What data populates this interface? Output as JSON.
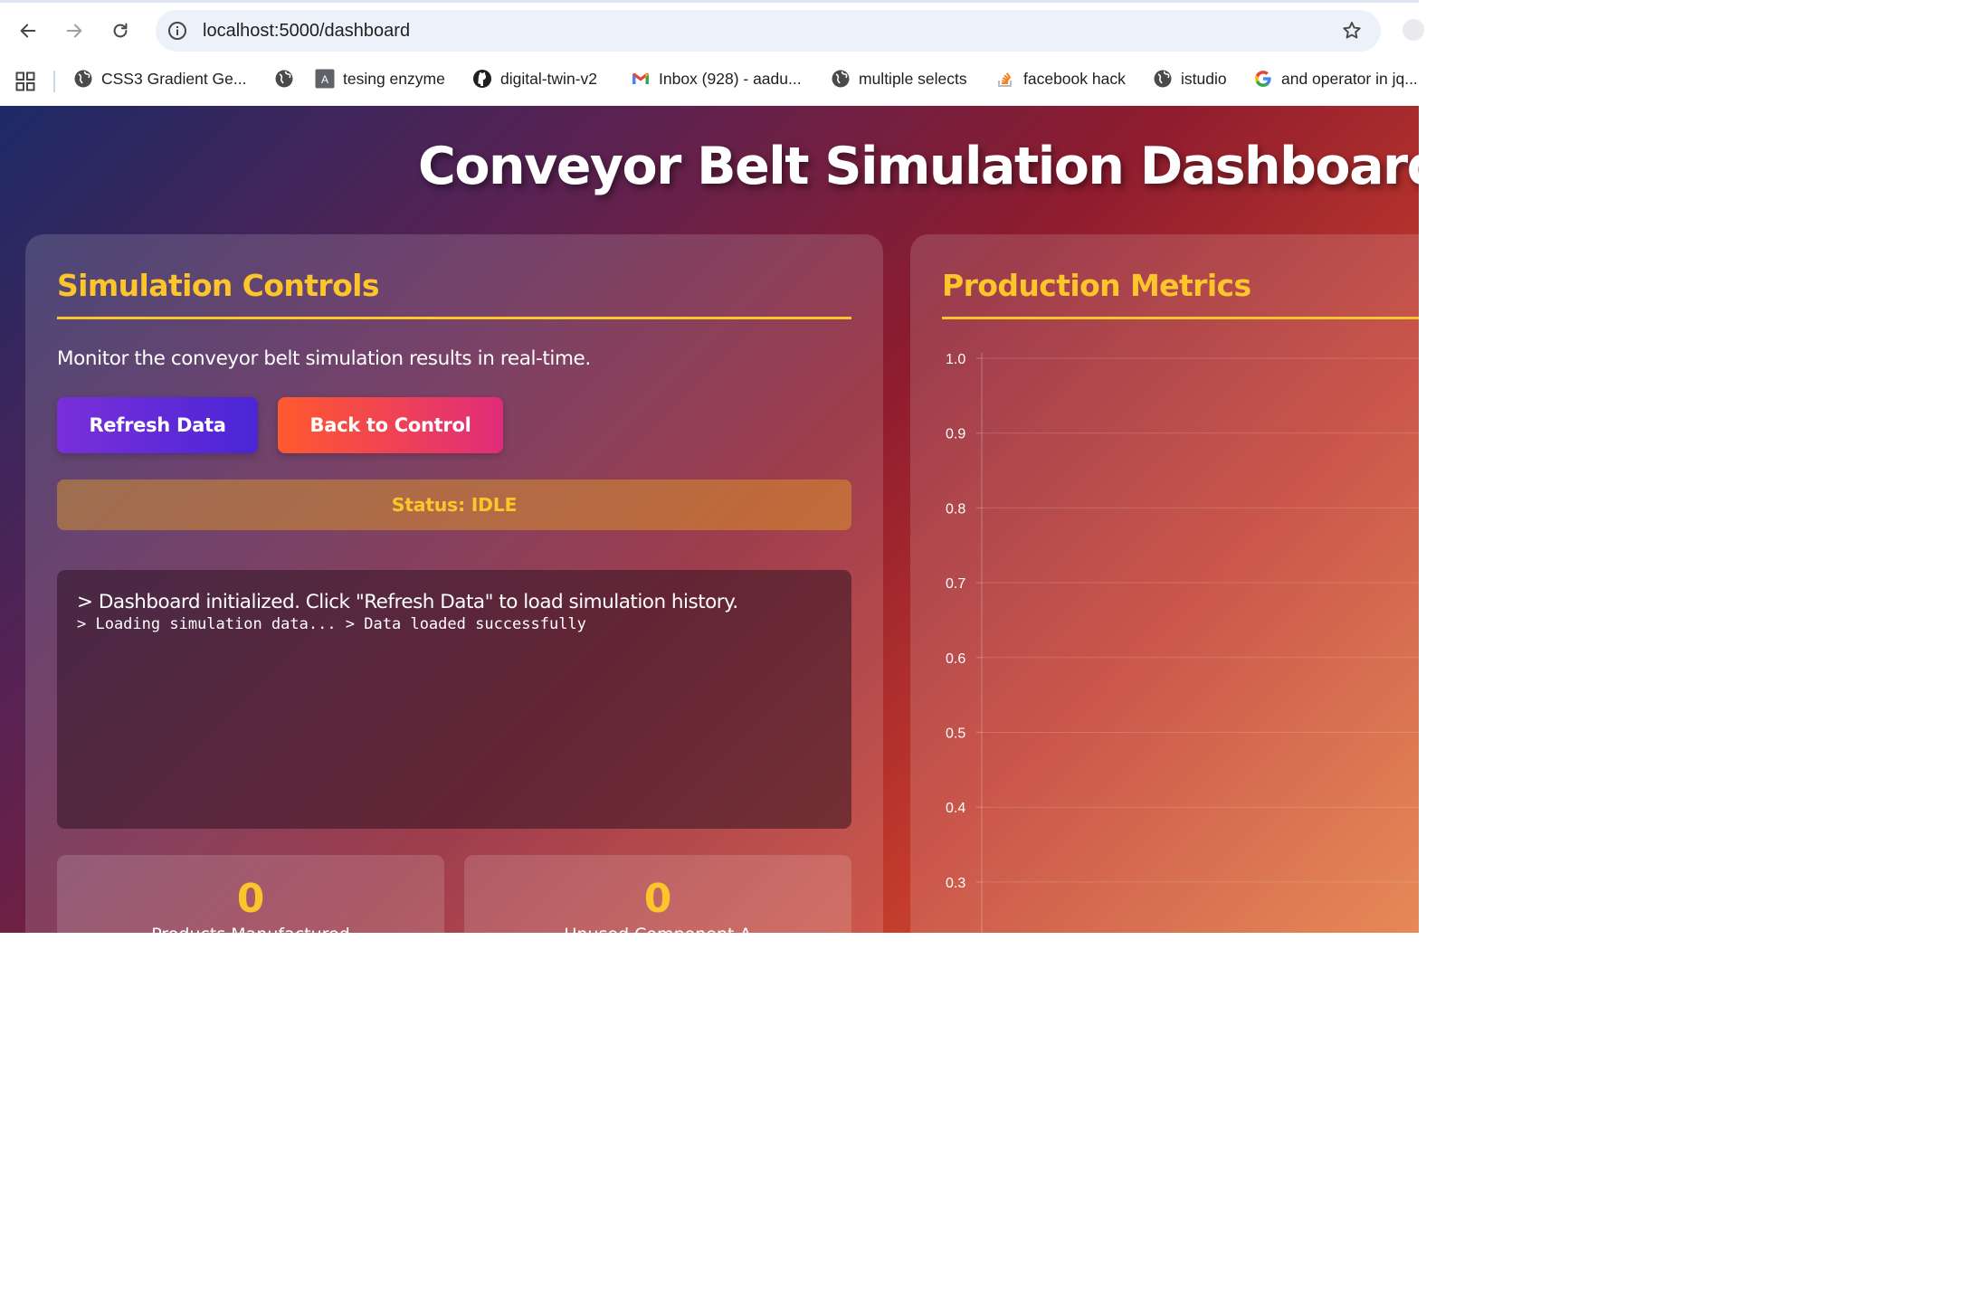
{
  "browser": {
    "url": "localhost:5000/dashboard",
    "bookmarks": [
      {
        "label": "CSS3 Gradient Ge...",
        "icon": "globe-icon"
      },
      {
        "label": "",
        "icon": "globe-icon"
      },
      {
        "label": "tesing enzyme",
        "icon": "letter-a-icon"
      },
      {
        "label": "digital-twin-v2",
        "icon": "github-icon"
      },
      {
        "label": "Inbox (928) - aadu...",
        "icon": "gmail-icon"
      },
      {
        "label": "multiple selects",
        "icon": "globe-icon"
      },
      {
        "label": "facebook hack",
        "icon": "stackoverflow-icon"
      },
      {
        "label": "istudio",
        "icon": "globe-icon"
      },
      {
        "label": "and operator in jq...",
        "icon": "google-icon"
      }
    ],
    "bookmark_a_letter": "A"
  },
  "page": {
    "title": "Conveyor Belt Simulation Dashboard"
  },
  "controls": {
    "heading": "Simulation Controls",
    "intro": "Monitor the conveyor belt simulation results in real-time.",
    "refresh_label": "Refresh Data",
    "back_label": "Back to Control",
    "status": "Status: IDLE",
    "console_line1": "> Dashboard initialized. Click \"Refresh Data\" to load simulation history.",
    "console_line2": "> Loading simulation data... > Data loaded successfully",
    "stats": [
      {
        "value": "0",
        "label": "Products Manufactured"
      },
      {
        "value": "0",
        "label": "Unused Component A"
      }
    ]
  },
  "metrics": {
    "heading": "Production Metrics"
  },
  "colors": {
    "accent": "#fbc52b",
    "refresh_button": "#5a28d8",
    "back_button": "#f2404f"
  },
  "chart_data": {
    "type": "line",
    "title": "",
    "xlabel": "",
    "ylabel": "",
    "ylim": [
      0,
      1.0
    ],
    "y_ticks": [
      "1.0",
      "0.9",
      "0.8",
      "0.7",
      "0.6",
      "0.5",
      "0.4",
      "0.3"
    ],
    "series": [],
    "grid": true
  }
}
